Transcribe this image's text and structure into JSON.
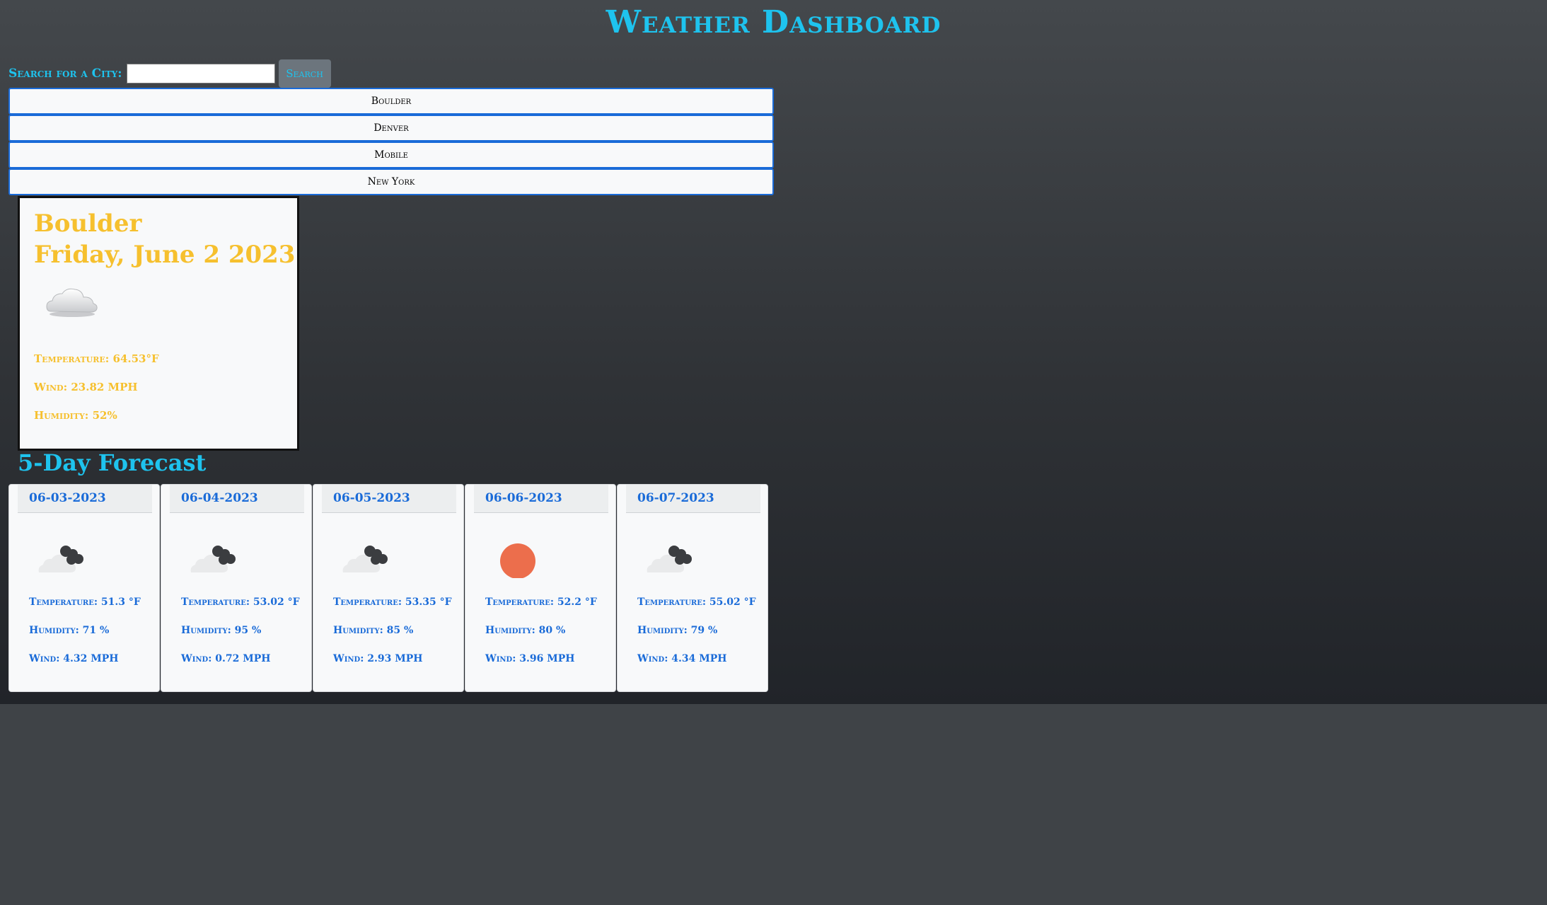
{
  "header": {
    "title": "Weather Dashboard"
  },
  "search": {
    "label": "Search for a City:",
    "value": "",
    "placeholder": "",
    "button_label": "Search"
  },
  "history": [
    "Boulder",
    "Denver",
    "Mobile",
    "New York"
  ],
  "current": {
    "city": "Boulder",
    "date": "Friday, June 2 2023",
    "icon": "cloud-icon",
    "temperature": "Temperature: 64.53°F",
    "wind": "Wind: 23.82 MPH",
    "humidity": "Humidity: 52%"
  },
  "forecast_heading": "5-Day Forecast",
  "forecast": [
    {
      "date": "06-03-2023",
      "icon": "cloudy-night-icon",
      "temperature": "Temperature: 51.3 °F",
      "humidity": "Humidity: 71 %",
      "wind": "Wind: 4.32 MPH"
    },
    {
      "date": "06-04-2023",
      "icon": "cloudy-night-icon",
      "temperature": "Temperature: 53.02 °F",
      "humidity": "Humidity: 95 %",
      "wind": "Wind: 0.72 MPH"
    },
    {
      "date": "06-05-2023",
      "icon": "cloudy-night-icon",
      "temperature": "Temperature: 53.35 °F",
      "humidity": "Humidity: 85 %",
      "wind": "Wind: 2.93 MPH"
    },
    {
      "date": "06-06-2023",
      "icon": "sun-icon",
      "temperature": "Temperature: 52.2 °F",
      "humidity": "Humidity: 80 %",
      "wind": "Wind: 3.96 MPH"
    },
    {
      "date": "06-07-2023",
      "icon": "cloudy-night-icon",
      "temperature": "Temperature: 55.02 °F",
      "humidity": "Humidity: 79 %",
      "wind": "Wind: 4.34 MPH"
    }
  ],
  "colors": {
    "accent_cyan": "#1ec3ee",
    "current_text": "#f6c02e",
    "forecast_text": "#1a6bd8",
    "sun": "#ec6e4c"
  }
}
